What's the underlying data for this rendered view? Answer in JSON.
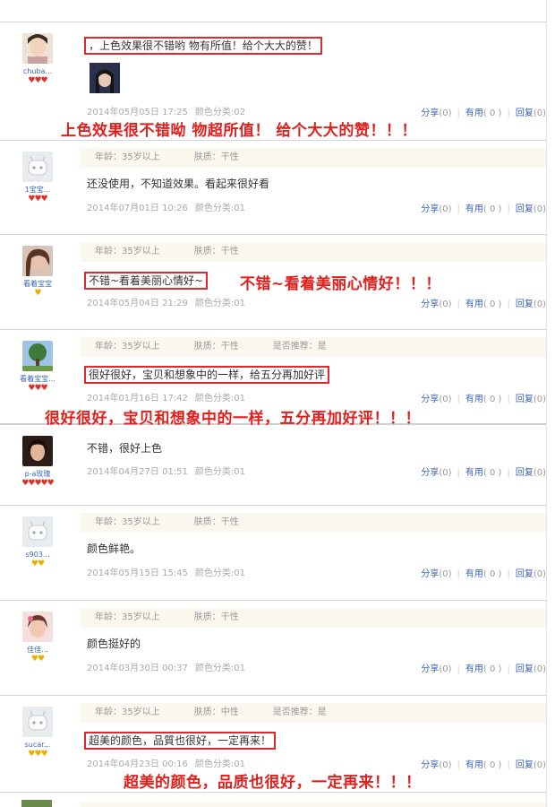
{
  "labels": {
    "share": "分享",
    "useful": "有用",
    "reply": "回复"
  },
  "reviews": [
    {
      "username": "chuba...",
      "level": "♥♥♥",
      "content": "，上色效果很不错哟 物有所值！给个大大的赞！",
      "date": "2014年05月05日 17:25",
      "color": "颜色分类:02",
      "share": "(0)",
      "useful": "( 0 )",
      "reply": "(0)",
      "note": "上色效果很不错呦 物超所值！ 给个大大的赞！！！"
    },
    {
      "username": "1宝宝...",
      "level": "♥♥♥",
      "age": "年龄：35岁以上",
      "skin": "肤质：干性",
      "content": "还没使用，不知道效果。看起来很好看",
      "date": "2014年07月01日 10:26",
      "color": "颜色分类:01",
      "share": "(0)",
      "useful": "( 0 )",
      "reply": "(0)"
    },
    {
      "username": "看着宝宝",
      "level": "♥",
      "age": "年龄：35岁以上",
      "skin": "肤质：干性",
      "content": "不错~看着美丽心情好~",
      "date": "2014年05月04日 21:29",
      "color": "颜色分类:01",
      "share": "(0)",
      "useful": "( 0 )",
      "reply": "(0)",
      "note": "不错~看着美丽心情好！！！"
    },
    {
      "username": "看着宝宝...",
      "level": "♥♥♥",
      "age": "年龄：35岁以上",
      "skin": "肤质：干性",
      "recommend": "是否推荐：是",
      "content": "很好很好，宝贝和想象中的一样，给五分再加好评",
      "date": "2014年01月16日 17:42",
      "color": "颜色分类:01",
      "share": "(0)",
      "useful": "( 0 )",
      "reply": "(0)",
      "note": "很好很好，宝贝和想象中的一样，五分再加好评！！！"
    },
    {
      "username": "p-a玫瑰",
      "level": "♥♥♥♥♥",
      "content": "不错，很好上色",
      "date": "2014年04月27日 01:51",
      "color": "颜色分类:01",
      "share": "(0)",
      "useful": "( 0 )",
      "reply": "(0)"
    },
    {
      "username": "s903...",
      "level": "♥♥",
      "age": "年龄：35岁以上",
      "skin": "肤质：干性",
      "content": "颜色鲜艳。",
      "date": "2014年05月15日 15:45",
      "color": "颜色分类:01",
      "share": "(0)",
      "useful": "( 0 )",
      "reply": "(0)"
    },
    {
      "username": "佳佳...",
      "level": "♥♥",
      "age": "年龄：35岁以上",
      "skin": "肤质：干性",
      "content": "颜色挺好的",
      "date": "2014年03月30日 00:37",
      "color": "颜色分类:01",
      "share": "(0)",
      "useful": "( 0 )",
      "reply": "(0)"
    },
    {
      "username": "sucar...",
      "level": "♥♥♥",
      "age": "年龄：35岁以上",
      "skin": "肤质：中性",
      "recommend": "是否推荐：是",
      "content": "超美的颜色，品質也很好，一定再来！",
      "date": "2014年04月23日 00:16",
      "color": "颜色分类:01",
      "share": "(0)",
      "useful": "( 0 )",
      "reply": "(0)",
      "note": "超美的颜色，品质也很好，一定再来！！！"
    }
  ]
}
